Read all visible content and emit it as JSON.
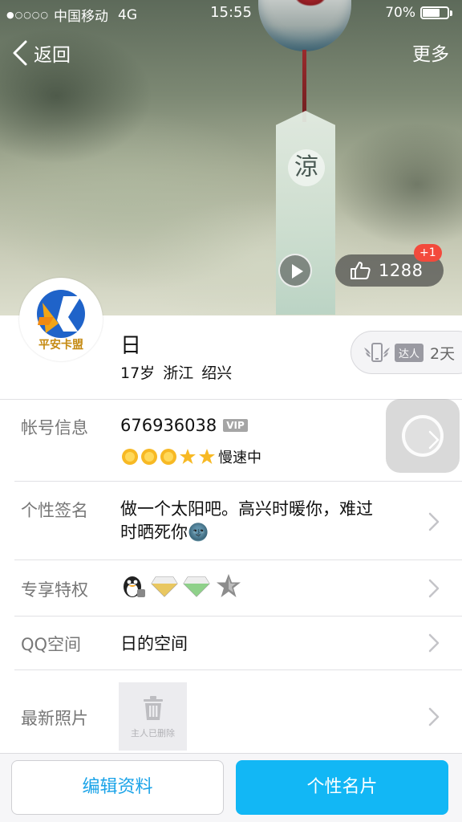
{
  "status_bar": {
    "signal_dots": "●○○○○",
    "carrier": "中国移动",
    "network": "4G",
    "time": "15:55",
    "battery_percent_label": "70%",
    "battery_level": 0.7
  },
  "nav": {
    "back_label": "返回",
    "more_label": "更多"
  },
  "cover": {
    "tag_character": "涼",
    "like_count": "1288",
    "like_badge": "+1"
  },
  "profile": {
    "avatar_text": "平安卡盟",
    "nickname": "日",
    "age": "17岁",
    "province": "浙江",
    "city": "绍兴",
    "daren_label": "达人",
    "daren_days": "2天"
  },
  "account_row": {
    "label": "帐号信息",
    "qq_number": "676936038",
    "vip_badge": "VIP",
    "level_icons": [
      "sun-icon",
      "sun-icon",
      "sun-icon",
      "star-icon",
      "star-icon"
    ],
    "level_status": "慢速中"
  },
  "signature_row": {
    "label": "个性签名",
    "line1": "做一个太阳吧。高兴时暖你，难过",
    "line2": "时晒死你",
    "emoji": "🌚"
  },
  "privilege_row": {
    "label": "专享特权",
    "icons": [
      "qq-penguin-icon",
      "gold-diamond-icon",
      "green-diamond-icon",
      "gray-star-icon"
    ]
  },
  "qzone_row": {
    "label": "QQ空间",
    "value": "日的空间"
  },
  "photos_row": {
    "label": "最新照片",
    "deleted_text": "主人已删除"
  },
  "bottom_bar": {
    "edit_label": "编辑资料",
    "card_label": "个性名片"
  },
  "colors": {
    "accent_blue": "#12b7f5",
    "edit_text_blue": "#1aa3e8",
    "badge_red": "#f34a3c",
    "divider": "#e1e1e4"
  }
}
